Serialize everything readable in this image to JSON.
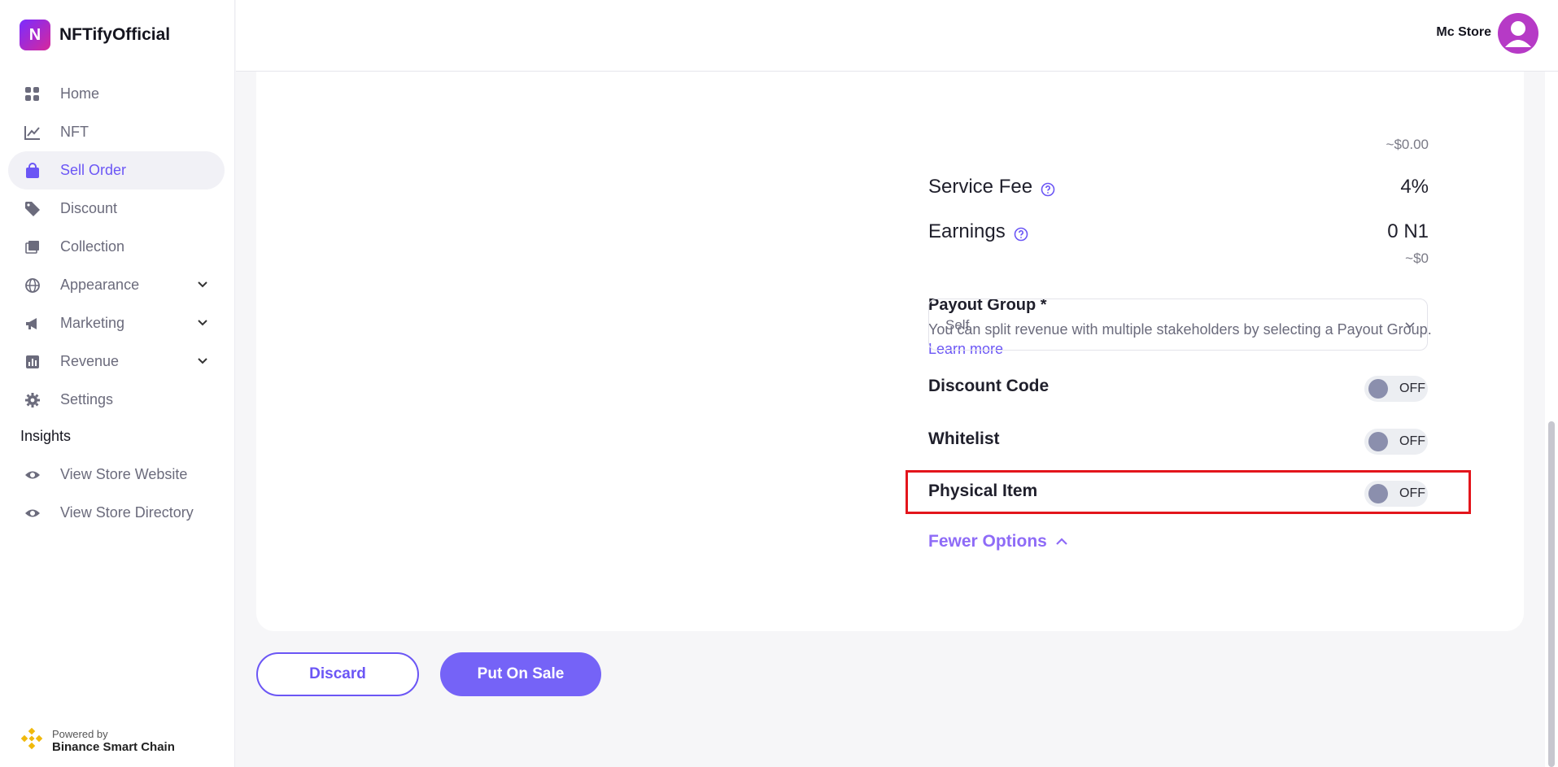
{
  "brand": {
    "name": "NFTifyOfficial",
    "logo_letter": "N"
  },
  "sidebar": {
    "items": [
      {
        "label": "Home",
        "icon": "grid-icon"
      },
      {
        "label": "NFT",
        "icon": "chart-line-icon"
      },
      {
        "label": "Sell Order",
        "icon": "shopping-bag-icon",
        "active": true
      },
      {
        "label": "Discount",
        "icon": "tag-icon"
      },
      {
        "label": "Collection",
        "icon": "images-icon"
      },
      {
        "label": "Appearance",
        "icon": "globe-icon",
        "expandable": true
      },
      {
        "label": "Marketing",
        "icon": "megaphone-icon",
        "expandable": true
      },
      {
        "label": "Revenue",
        "icon": "bar-chart-icon",
        "expandable": true
      },
      {
        "label": "Settings",
        "icon": "gear-icon"
      }
    ],
    "insights_title": "Insights",
    "insights_items": [
      {
        "label": "View Store Website",
        "icon": "eye-icon"
      },
      {
        "label": "View Store Directory",
        "icon": "eye-icon"
      }
    ],
    "powered_by": {
      "line1": "Powered by",
      "line2": "Binance Smart Chain"
    }
  },
  "header": {
    "user_name": "Mc Store"
  },
  "form": {
    "top_usd": "~$0.00",
    "service_fee": {
      "label": "Service Fee",
      "value": "4%"
    },
    "earnings": {
      "label": "Earnings",
      "value": "0 N1",
      "usd": "~$0"
    },
    "payout": {
      "title": "Payout Group *",
      "desc": "You can split revenue with multiple stakeholders by selecting a Payout Group.",
      "link": "Learn more",
      "selected": "Self"
    },
    "discount_code": {
      "label": "Discount Code",
      "state": "OFF"
    },
    "whitelist": {
      "label": "Whitelist",
      "state": "OFF"
    },
    "physical_item": {
      "label": "Physical Item",
      "state": "OFF"
    },
    "fewer_options": "Fewer Options"
  },
  "actions": {
    "discard": "Discard",
    "put_on_sale": "Put On Sale"
  },
  "colors": {
    "accent": "#6b56f5",
    "highlight": "#e3151c"
  }
}
